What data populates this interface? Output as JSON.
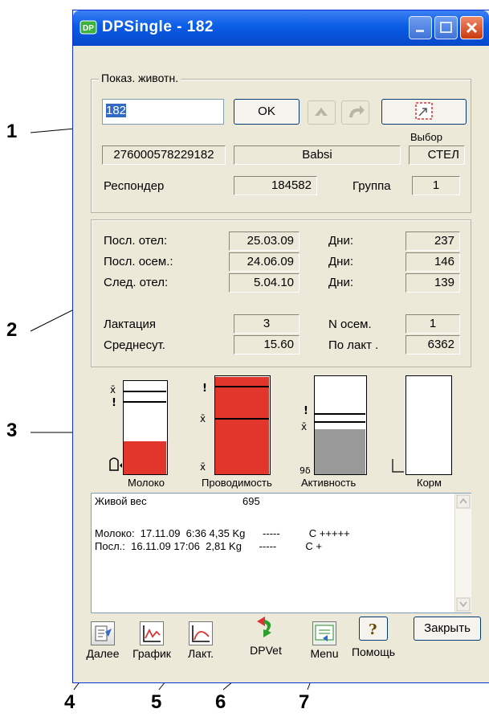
{
  "window": {
    "title": "DPSingle - 182"
  },
  "animal_group": {
    "legend": "Показ. животн.",
    "animal_input": "182",
    "ok_label": "OK",
    "select_label": "Выбор",
    "id_number": "276000578229182",
    "name": "Babsi",
    "status": "СТЕЛ",
    "responder_label": "Респондер",
    "responder_value": "184582",
    "group_label": "Группа",
    "group_value": "1"
  },
  "dates": {
    "rows": [
      {
        "label": "Посл. отел:",
        "date": "25.03.09",
        "days_label": "Дни:",
        "days": "237"
      },
      {
        "label": "Посл. осем.:",
        "date": "24.06.09",
        "days_label": "Дни:",
        "days": "146"
      },
      {
        "label": "След. отел:",
        "date": "5.04.10",
        "days_label": "Дни:",
        "days": "139"
      }
    ],
    "lactation_label": "Лактация",
    "lactation_value": "3",
    "insem_label": "N осем.",
    "insem_value": "1",
    "avg_label": "Среднесут.",
    "avg_value": "15.60",
    "per_lact_label": "По лакт .",
    "per_lact_value": "6362"
  },
  "indicators": [
    {
      "label": "Молоко",
      "level": 0.36
    },
    {
      "label": "Проводимость",
      "level": 1.0
    },
    {
      "label": "Активность",
      "level": 0.46
    },
    {
      "label": "Корм",
      "level": 0.0
    }
  ],
  "info": {
    "weight_label": "Живой вес",
    "weight_value": "695",
    "line1": "Молоко:  17.11.09  6:36 4,35 Kg      -----          C +++++",
    "line2": "Посл.:  16.11.09 17:06  2,81 Kg      -----          C +"
  },
  "toolbar": {
    "next": "Далее",
    "graph": "График",
    "lact": "Лакт.",
    "dpvet": "DPVet",
    "menu": "Menu",
    "help": "Помощь",
    "close": "Закрыть"
  },
  "callouts": [
    "1",
    "2",
    "3",
    "4",
    "5",
    "6",
    "7"
  ]
}
